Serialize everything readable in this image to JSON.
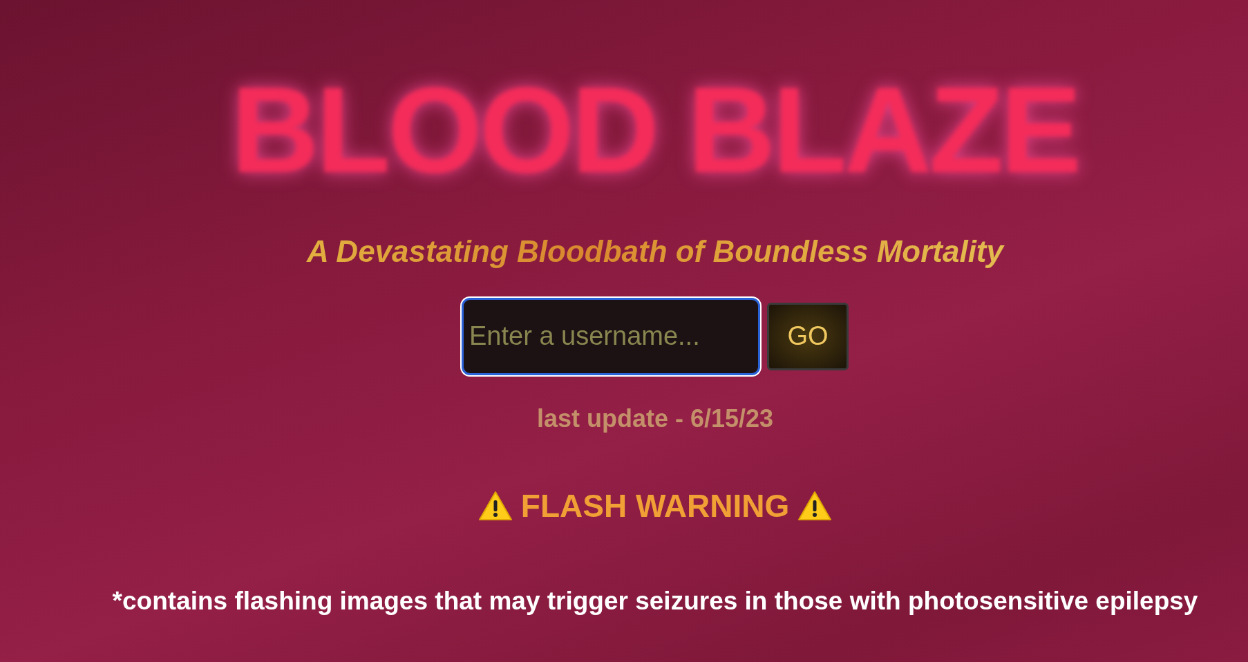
{
  "title": "BLOOD BLAZE",
  "subtitle": "A Devastating Bloodbath of Boundless Mortality",
  "login": {
    "placeholder": "Enter a username...",
    "focused": true,
    "button": "GO"
  },
  "last_update": "last update - 6/15/23",
  "warning": {
    "heading": "FLASH WARNING",
    "note": "*contains flashing images that may trigger seizures in those with photosensitive epilepsy"
  }
}
